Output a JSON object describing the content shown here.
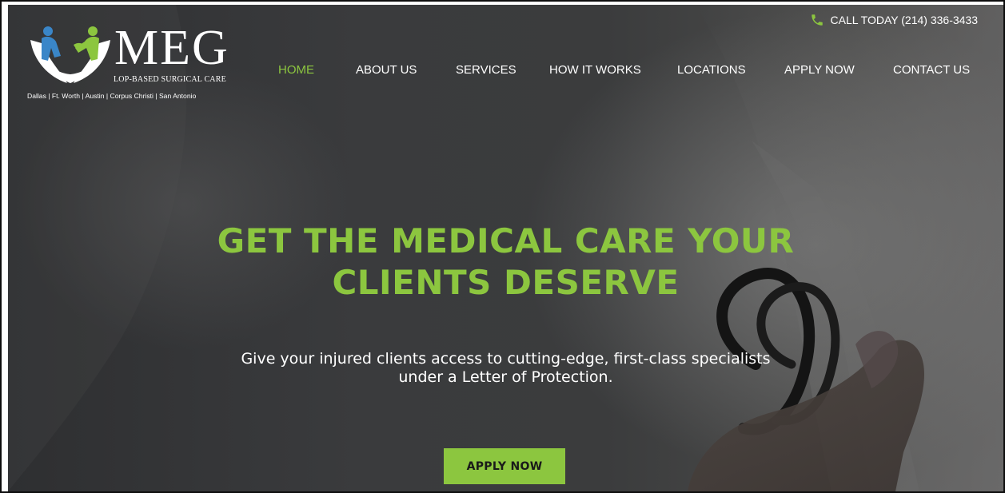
{
  "brand": {
    "name": "MEG",
    "tagline": "LOP-BASED SURGICAL CARE",
    "cities": "Dallas | Ft. Worth | Austin | Corpus Christi | San Antonio"
  },
  "topbar": {
    "phone_text": "CALL TODAY (214) 336-3433",
    "phone_icon": "phone-icon"
  },
  "nav": {
    "items": [
      {
        "label": "HOME",
        "active": true
      },
      {
        "label": "ABOUT US",
        "active": false
      },
      {
        "label": "SERVICES",
        "active": false
      },
      {
        "label": "HOW IT WORKS",
        "active": false
      },
      {
        "label": "LOCATIONS",
        "active": false
      },
      {
        "label": "APPLY NOW",
        "active": false
      },
      {
        "label": "CONTACT US",
        "active": false
      }
    ]
  },
  "hero": {
    "headline_line1": "GET THE MEDICAL CARE YOUR",
    "headline_line2": "CLIENTS DESERVE",
    "sub_line1": "Give your injured clients access to cutting-edge, first-class specialists",
    "sub_line2": "under a Letter of Protection.",
    "cta_label": "APPLY NOW"
  },
  "colors": {
    "accent": "#8cc63f",
    "logo_blue": "#3a86c8",
    "hero_text": "#ffffff"
  }
}
